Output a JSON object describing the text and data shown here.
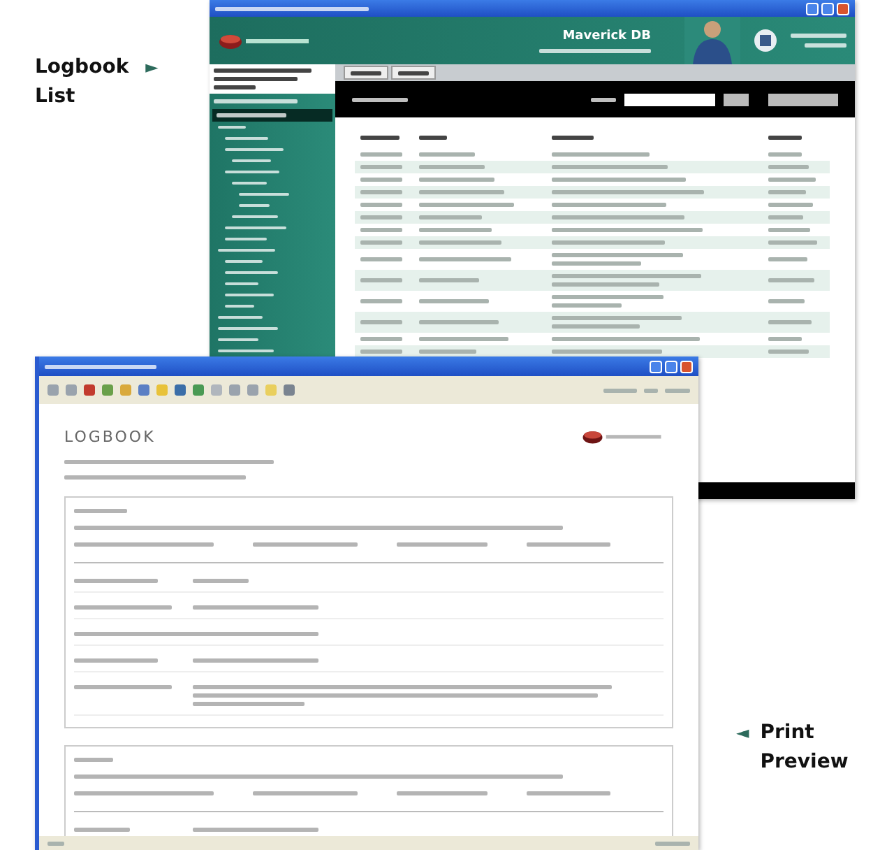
{
  "callouts": [
    {
      "lines": [
        "Logbook",
        "List"
      ],
      "arrow": "►",
      "kind": "arrow-after"
    },
    {
      "lines": [
        "Print",
        "Preview"
      ],
      "arrow": "◄",
      "kind": "arrow-before"
    }
  ],
  "list_window": {
    "header_title": "Maverick DB"
  },
  "preview_window": {
    "heading": "LOGBOOK"
  }
}
